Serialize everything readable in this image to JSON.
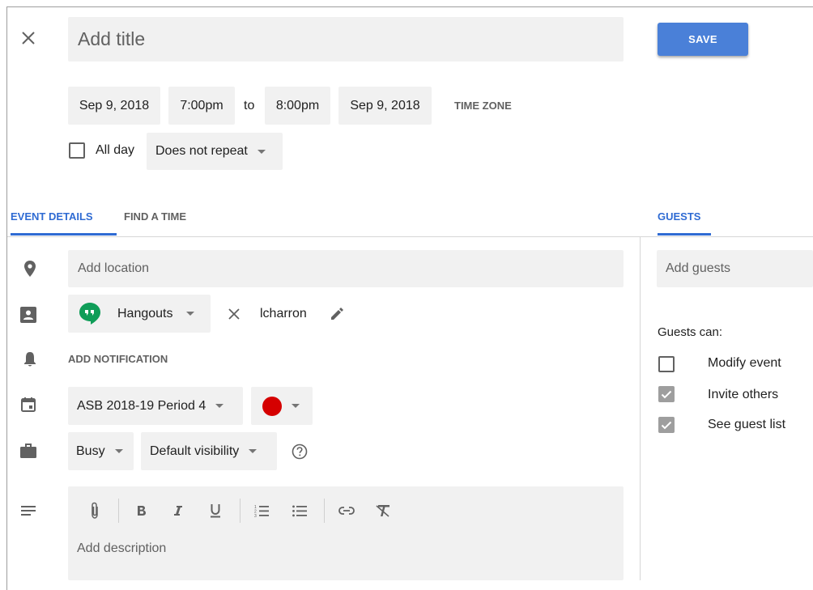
{
  "header": {
    "title_placeholder": "Add title",
    "save_label": "SAVE"
  },
  "datetime": {
    "start_date": "Sep 9, 2018",
    "start_time": "7:00pm",
    "to_label": "to",
    "end_time": "8:00pm",
    "end_date": "Sep 9, 2018",
    "time_zone_label": "TIME ZONE",
    "all_day_label": "All day",
    "all_day_checked": false,
    "repeat_value": "Does not repeat"
  },
  "tabs": [
    {
      "label": "EVENT DETAILS",
      "active": true
    },
    {
      "label": "FIND A TIME",
      "active": false
    }
  ],
  "guests_tab": {
    "label": "GUESTS",
    "active": true
  },
  "details": {
    "location_placeholder": "Add location",
    "conference_label": "Hangouts",
    "conference_id": "lcharron",
    "add_notification_label": "ADD NOTIFICATION",
    "calendar_value": "ASB 2018-19 Period 4",
    "event_color": "#d50000",
    "availability_value": "Busy",
    "visibility_value": "Default visibility",
    "description_placeholder": "Add description"
  },
  "guests": {
    "add_guests_placeholder": "Add guests",
    "permissions_heading": "Guests can:",
    "permissions": [
      {
        "label": "Modify event",
        "checked": false
      },
      {
        "label": "Invite others",
        "checked": true
      },
      {
        "label": "See guest list",
        "checked": true
      }
    ]
  },
  "colors": {
    "accent": "#2f6bd3",
    "save_button": "#4a80d8",
    "hangouts_green": "#0f9d58",
    "field_bg": "#f1f1f1"
  },
  "icons": {
    "close": "close-icon",
    "location": "location-pin-icon",
    "conference": "conference-icon",
    "notification": "bell-icon",
    "calendar": "calendar-icon",
    "availability": "briefcase-icon",
    "description": "notes-icon",
    "help": "help-icon",
    "edit": "pencil-icon"
  }
}
